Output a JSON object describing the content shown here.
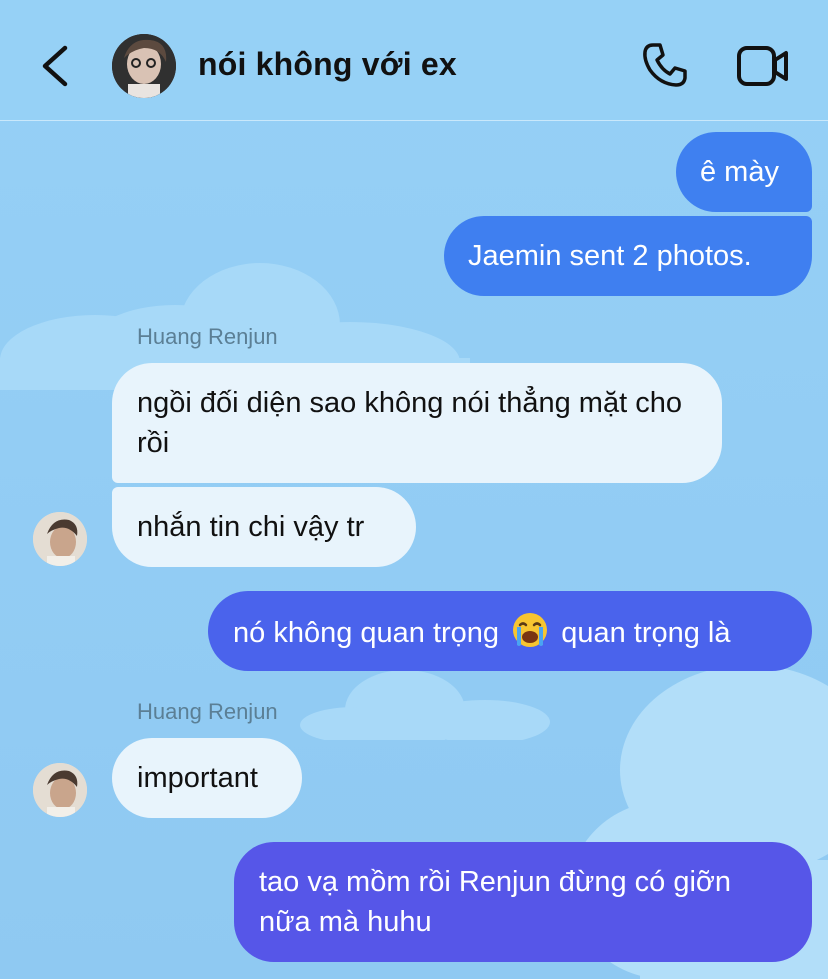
{
  "header": {
    "title": "nói không với ex"
  },
  "messages": {
    "m1": "ê mày",
    "m2": "Jaemin sent 2 photos.",
    "sender1": "Huang Renjun",
    "m3": "ngồi đối diện sao không nói thẳng mặt cho rồi",
    "m4": "nhắn tin chi vậy tr",
    "m5_before": "nó không quan trọng",
    "m5_after": "quan trọng là",
    "sender2": "Huang Renjun",
    "m6": "important",
    "m7": "tao vạ mồm rồi Renjun đừng có giỡn nữa mà huhu"
  },
  "colors": {
    "background": "#94cff5",
    "bubble_incoming": "#e8f4fc",
    "bubble_out_1": "#3f7ff0",
    "bubble_out_2": "#4a63ec",
    "bubble_out_3": "#5656e8"
  },
  "icons": {
    "back": "chevron-left-icon",
    "call": "phone-icon",
    "video": "video-camera-icon",
    "emoji": "loudly-crying-face-emoji"
  }
}
